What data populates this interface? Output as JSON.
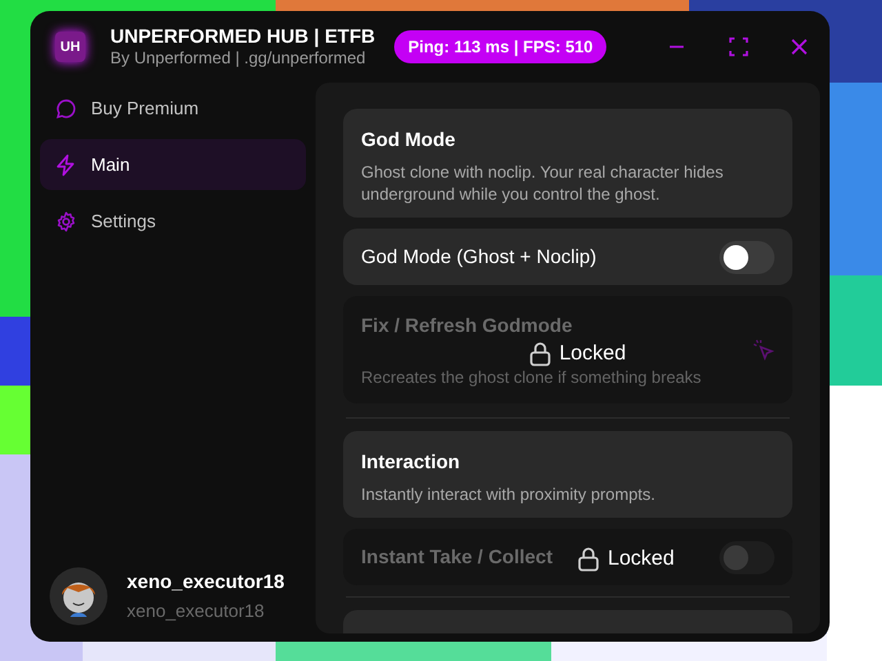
{
  "window": {
    "logo": "UH",
    "title": "UNPERFORMED HUB | ETFB",
    "subtitle": "By Unperformed | .gg/unperformed",
    "stats": "Ping: 113 ms | FPS: 510"
  },
  "sidebar": {
    "items": [
      {
        "label": "Buy Premium",
        "selected": false
      },
      {
        "label": "Main",
        "selected": true
      },
      {
        "label": "Settings",
        "selected": false
      }
    ],
    "profile": {
      "name": "xeno_executor18",
      "username": "xeno_executor18"
    }
  },
  "content": {
    "items": [
      {
        "kind": "section",
        "title": "God Mode",
        "description": "Ghost clone with noclip. Your real character hides underground while you control the ghost."
      },
      {
        "kind": "toggle",
        "title": "God Mode (Ghost + Noclip)",
        "on": false,
        "locked": false
      },
      {
        "kind": "button",
        "title": "Fix / Refresh Godmode",
        "description": "Recreates the ghost clone if something breaks",
        "locked": true,
        "lock_label": "Locked"
      },
      {
        "kind": "divider"
      },
      {
        "kind": "section",
        "title": "Interaction",
        "description": "Instantly interact with proximity prompts."
      },
      {
        "kind": "toggle",
        "title": "Instant Take / Collect",
        "on": false,
        "locked": true,
        "lock_label": "Locked"
      },
      {
        "kind": "divider"
      },
      {
        "kind": "blank"
      }
    ]
  }
}
